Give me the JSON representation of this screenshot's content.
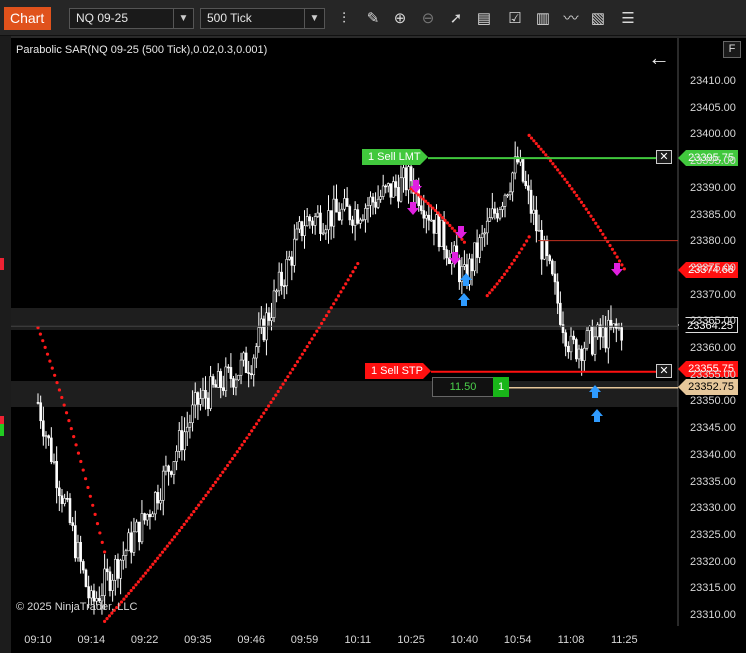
{
  "toolbar": {
    "chart_tab": "Chart",
    "instrument": "NQ 09-25",
    "interval": "500 Tick",
    "icons": [
      "bar-type-icon",
      "draw-pencil-icon",
      "zoom-in-icon",
      "zoom-out-icon",
      "pointer-icon",
      "data-box-icon",
      "properties-icon",
      "chart-trader-icon",
      "indicators-icon",
      "strategies-icon",
      "more-icon"
    ]
  },
  "chart": {
    "indicator_label": "Parabolic SAR(NQ 09-25 (500 Tick),0.02,0.3,0.001)",
    "copyright": "© 2025 NinjaTrader, LLC",
    "f_button": "F",
    "price_axis": [
      "23410.00",
      "23405.00",
      "23400.00",
      "23395.00",
      "23390.00",
      "23385.00",
      "23380.00",
      "23375.00",
      "23370.00",
      "23365.00",
      "23360.00",
      "23355.00",
      "23350.00",
      "23345.00",
      "23340.00",
      "23335.00",
      "23330.00",
      "23325.00",
      "23320.00",
      "23315.00",
      "23310.00"
    ],
    "time_axis": [
      "09:10",
      "09:14",
      "09:22",
      "09:35",
      "09:46",
      "09:59",
      "10:11",
      "10:25",
      "10:40",
      "10:54",
      "11:08",
      "11:25"
    ],
    "price_tags": {
      "sell_lmt": "23395.75",
      "sar": "23374.68",
      "last": "23364.25",
      "sell_stp": "23355.75",
      "position": "23352.75"
    },
    "orders": {
      "sell_lmt_label": "1  Sell LMT",
      "sell_stp_label": "1  Sell STP",
      "close_glyph": "✕"
    },
    "position": {
      "pnl": "11.50",
      "qty": "1"
    },
    "colors": {
      "background": "#000000",
      "candle": "#ffffff",
      "sar": "#ff1a1a",
      "sell_lmt": "#41c83d",
      "sell_stp": "#ff1010",
      "position": "#e6c79a",
      "signal_down": "#e020e0",
      "signal_up": "#2f9bff",
      "last_price": "#d8d8d8"
    }
  },
  "chart_data": {
    "type": "candlestick",
    "instrument": "NQ 09-25",
    "interval": "500 Tick",
    "ylim": [
      23308.5,
      23413.5
    ],
    "x": [
      "09:10",
      "09:14",
      "09:22",
      "09:35",
      "09:46",
      "09:59",
      "10:11",
      "10:25",
      "10:40",
      "10:54",
      "11:08",
      "11:25"
    ],
    "close_path": [
      [
        "09:10",
        23350
      ],
      [
        "09:14",
        23312
      ],
      [
        "09:22",
        23328
      ],
      [
        "09:35",
        23350
      ],
      [
        "09:46",
        23358
      ],
      [
        "09:59",
        23384
      ],
      [
        "10:11",
        23386
      ],
      [
        "10:25",
        23392
      ],
      [
        "10:40",
        23373
      ],
      [
        "10:54",
        23395
      ],
      [
        "11:08",
        23360
      ],
      [
        "11:25",
        23364
      ]
    ],
    "sar_series": [
      {
        "from": [
          "09:10",
          23364
        ],
        "to": [
          "09:16",
          23322
        ]
      },
      {
        "from": [
          "09:16",
          23309
        ],
        "to": [
          "10:11",
          23376
        ]
      },
      {
        "from": [
          "10:25",
          23390
        ],
        "to": [
          "10:40",
          23380
        ]
      },
      {
        "from": [
          "10:46",
          23370
        ],
        "to": [
          "10:57",
          23381
        ]
      },
      {
        "from": [
          "10:57",
          23400
        ],
        "to": [
          "11:25",
          23375
        ]
      }
    ],
    "levels": {
      "sell_lmt": 23395.75,
      "sar": 23374.68,
      "last": 23364.25,
      "sell_stp": 23355.75,
      "position": 23352.75
    }
  }
}
